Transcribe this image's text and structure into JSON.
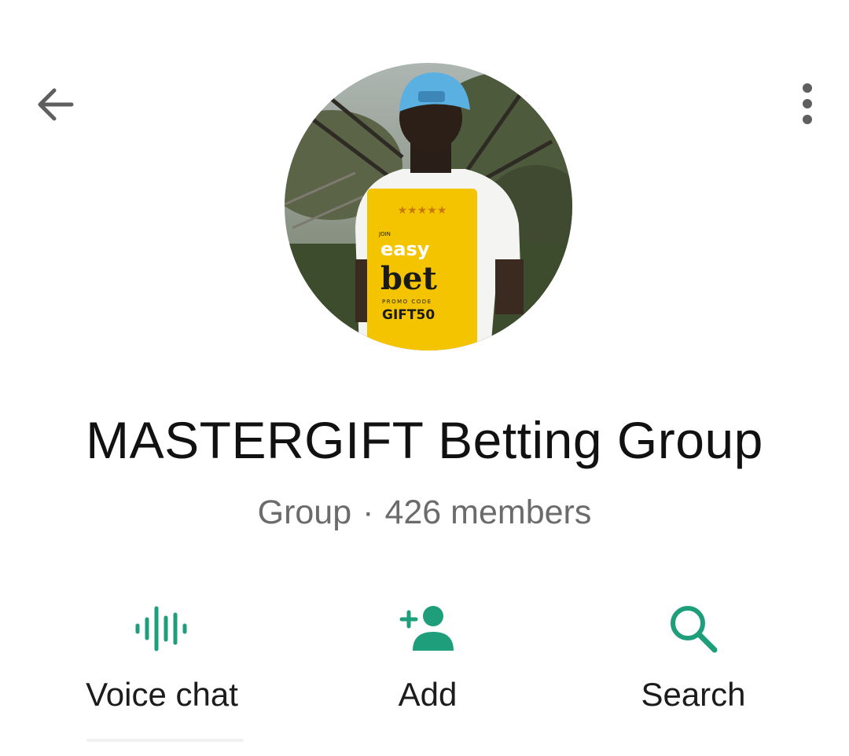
{
  "header": {
    "back_icon": "arrow-left-icon",
    "menu_icon": "more-vertical-icon"
  },
  "profile": {
    "group_name": "MASTERGIFT Betting Group",
    "type_label": "Group",
    "separator": "·",
    "members_label": "426 members",
    "avatar_text": {
      "join": "JOIN",
      "brand_top": "easy",
      "brand_bottom": "bet",
      "promo_label": "PROMO CODE",
      "promo_code": "GIFT50"
    }
  },
  "actions": [
    {
      "label": "Voice chat",
      "icon": "voice-wave-icon"
    },
    {
      "label": "Add",
      "icon": "add-person-icon"
    },
    {
      "label": "Search",
      "icon": "search-icon"
    }
  ],
  "colors": {
    "accent": "#1f9e7c",
    "text_primary": "#111111",
    "text_secondary": "#6b6b6b",
    "icon_gray": "#5f5f5f"
  }
}
